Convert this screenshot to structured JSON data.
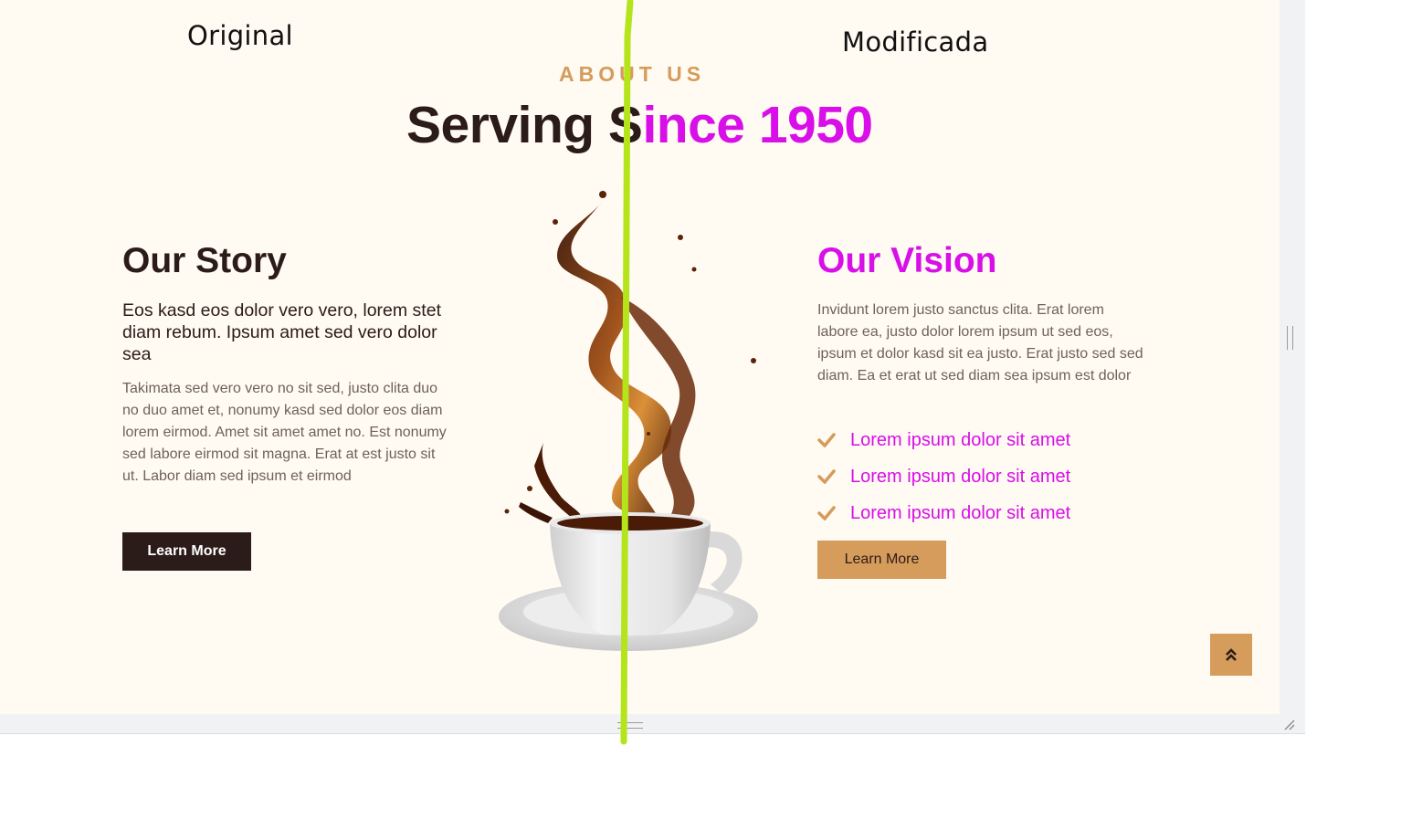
{
  "labels": {
    "original": "Original",
    "modified": "Modificada"
  },
  "section": {
    "eyebrow": "ABOUT US",
    "headline_part1": "Serving S",
    "headline_part2": "ince 1950"
  },
  "story": {
    "title": "Our Story",
    "lead": "Eos kasd eos dolor vero vero, lorem stet diam rebum. Ipsum amet sed vero dolor sea",
    "body": "Takimata sed vero vero no sit sed, justo clita duo no duo amet et, nonumy kasd sed dolor eos diam lorem eirmod. Amet sit amet amet no. Est nonumy sed labore eirmod sit magna. Erat at est justo sit ut. Labor diam sed ipsum et eirmod",
    "button": "Learn More"
  },
  "vision": {
    "title": "Our Vision",
    "body": "Invidunt lorem justo sanctus clita. Erat lorem labore ea, justo dolor lorem ipsum ut sed eos, ipsum et dolor kasd sit ea justo. Erat justo sed sed diam. Ea et erat ut sed diam sea ipsum est dolor",
    "checklist": [
      "Lorem ipsum dolor sit amet",
      "Lorem ipsum dolor sit amet",
      "Lorem ipsum dolor sit amet"
    ],
    "button": "Learn More"
  },
  "icons": {
    "check": "check-icon",
    "back_to_top": "double-chevron-up-icon",
    "image": "coffee-cup-splash-image"
  },
  "colors": {
    "background": "#fffaf2",
    "primary_dark": "#2c1c19",
    "accent_gold": "#d59c5b",
    "highlight_magenta": "#d80fe8",
    "divider_green": "#b4e41a"
  }
}
